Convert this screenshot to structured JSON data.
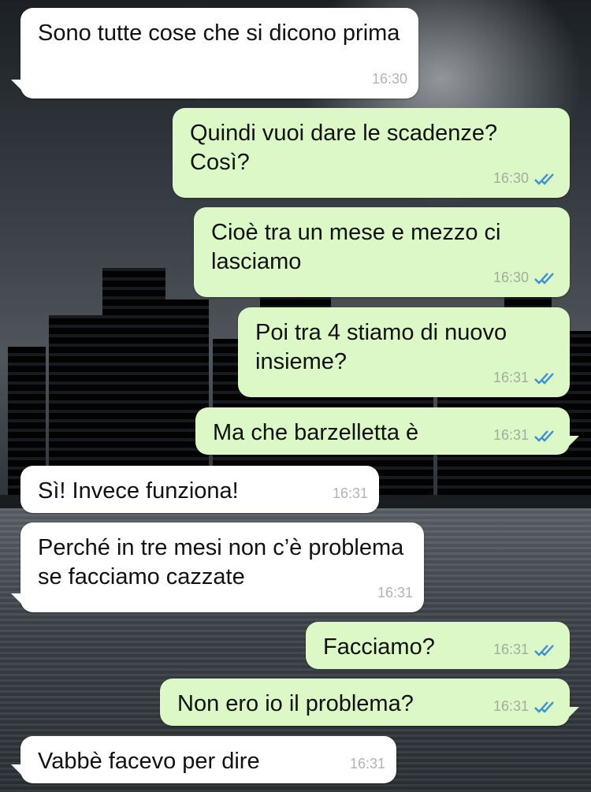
{
  "messages": [
    {
      "direction": "in",
      "text": "Sono tutte cose che si dicono prima",
      "time": "16:30"
    },
    {
      "direction": "out",
      "text": "Quindi vuoi dare le scadenze? Così?",
      "time": "16:30",
      "status": "read-icon"
    },
    {
      "direction": "out",
      "text": "Cioè tra un mese e mezzo ci lasciamo",
      "time": "16:30",
      "status": "read-icon"
    },
    {
      "direction": "out",
      "text": "Poi tra 4 stiamo di nuovo insieme?",
      "time": "16:31",
      "status": "read-icon"
    },
    {
      "direction": "out",
      "text": "Ma che barzelletta è",
      "time": "16:31",
      "status": "read-icon"
    },
    {
      "direction": "in",
      "text": "Sì! Invece funziona!",
      "time": "16:31"
    },
    {
      "direction": "in",
      "text": "Perché in tre mesi non c’è problema se facciamo cazzate",
      "time": "16:31"
    },
    {
      "direction": "out",
      "text": "Facciamo?",
      "time": "16:31",
      "status": "read-icon"
    },
    {
      "direction": "out",
      "text": "Non ero io il problema?",
      "time": "16:31",
      "status": "read-icon"
    },
    {
      "direction": "in",
      "text": "Vabbè facevo per dire",
      "time": "16:31"
    }
  ],
  "colors": {
    "incoming": "#ffffff",
    "outgoing": "#dcf8c6",
    "read_ticks": "#3a8fd6"
  }
}
